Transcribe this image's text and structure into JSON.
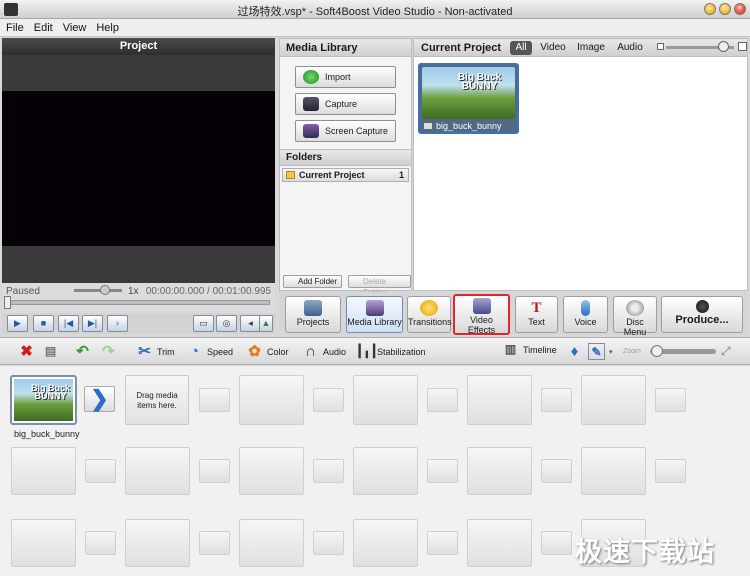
{
  "window": {
    "title": "过场特效.vsp* - Soft4Boost Video Studio - Non-activated"
  },
  "menu": [
    "File",
    "Edit",
    "View",
    "Help"
  ],
  "project_panel": {
    "header": "Project",
    "status": "Paused",
    "speed": "1x",
    "time_current": "00:00:00.000",
    "time_separator": "/",
    "time_total": "00:01:00.995"
  },
  "media_library": {
    "header": "Media Library",
    "buttons": [
      "Import",
      "Capture",
      "Screen Capture"
    ],
    "folders_header": "Folders",
    "folder": {
      "name": "Current Project",
      "count": "1"
    },
    "add_folder": "Add Folder",
    "delete_folder": "Delete Folder"
  },
  "current_project": {
    "header": "Current Project",
    "tabs": [
      "All",
      "Video",
      "Image",
      "Audio"
    ],
    "active_tab": "All",
    "items": [
      {
        "name": "big_buck_bunny",
        "thumb_text": "Big Buck BUNNY"
      }
    ]
  },
  "tabs": [
    {
      "label": "Projects"
    },
    {
      "label": "Media Library"
    },
    {
      "label": "Transitions"
    },
    {
      "label": "Video Effects"
    },
    {
      "label": "Text"
    },
    {
      "label": "Voice"
    },
    {
      "label": "Disc Menu"
    },
    {
      "label": "Produce..."
    }
  ],
  "edit_toolbar": {
    "trim": "Trim",
    "speed": "Speed",
    "color": "Color",
    "audio": "Audio",
    "stabilization": "Stabilization",
    "timeline": "Timeline",
    "zoom": "Zoom"
  },
  "storyboard": {
    "clip_name": "big_buck_bunny",
    "clip_thumb_text": "Big Buck BUNNY",
    "drop_hint": "Drag media items here."
  },
  "watermark": "极速下载站",
  "colors": {
    "highlight_border": "#e0262a",
    "accent_blue": "#2b6cc4",
    "selected_border": "#3f6fb5"
  }
}
